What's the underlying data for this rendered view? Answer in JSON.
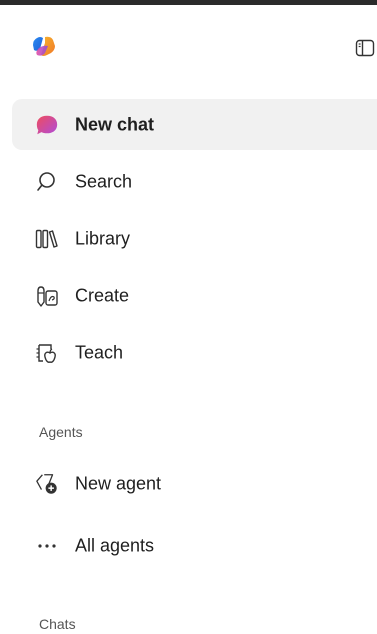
{
  "colors": {
    "active_bg": "#f1f1f1",
    "text": "#1f1f1f",
    "section_text": "#555555",
    "new_chat_icon_gradient": [
      "#e84a6f",
      "#b04bd9"
    ]
  },
  "header": {
    "logo_icon": "copilot-logo",
    "toggle_icon": "sidebar-toggle-icon"
  },
  "nav": {
    "new_chat": "New chat",
    "search": "Search",
    "library": "Library",
    "create": "Create",
    "teach": "Teach"
  },
  "agents": {
    "heading": "Agents",
    "new_agent": "New agent",
    "all_agents": "All agents"
  },
  "chats": {
    "heading": "Chats"
  }
}
